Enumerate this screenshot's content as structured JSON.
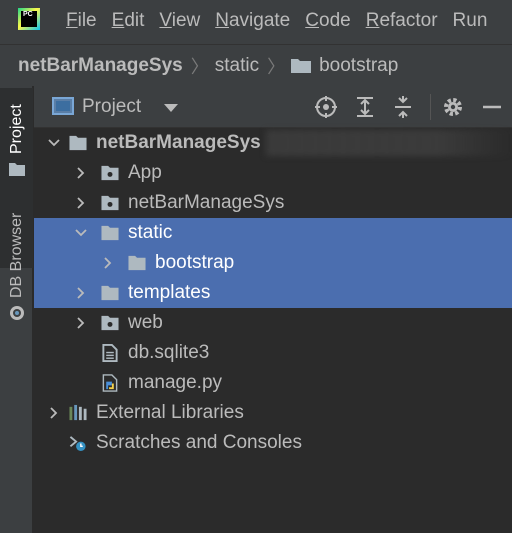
{
  "menu": {
    "logo_text": "PC",
    "items": [
      {
        "mnemonic": "F",
        "rest": "ile"
      },
      {
        "mnemonic": "E",
        "rest": "dit"
      },
      {
        "mnemonic": "V",
        "rest": "iew"
      },
      {
        "mnemonic": "N",
        "rest": "avigate"
      },
      {
        "mnemonic": "C",
        "rest": "ode"
      },
      {
        "mnemonic": "R",
        "rest": "efactor"
      },
      {
        "mnemonic": "",
        "rest": "Run"
      }
    ]
  },
  "breadcrumb": {
    "root": "netBarManageSys",
    "items": [
      "static",
      "bootstrap"
    ]
  },
  "toolstrip": {
    "project_label": "Project",
    "db_label": "DB Browser"
  },
  "panel": {
    "title": "Project"
  },
  "tree": {
    "rows": [
      {
        "label": "netBarManageSys",
        "icon": "folder-icon",
        "level": 0,
        "arrow": "down",
        "selected": false,
        "bold": true
      },
      {
        "label": "App",
        "icon": "package-folder-icon",
        "level": 1,
        "arrow": "right",
        "selected": false
      },
      {
        "label": "netBarManageSys",
        "icon": "package-folder-icon",
        "level": 1,
        "arrow": "right",
        "selected": false
      },
      {
        "label": "static",
        "icon": "folder-icon",
        "level": 1,
        "arrow": "down",
        "selected": true
      },
      {
        "label": "bootstrap",
        "icon": "folder-icon",
        "level": 2,
        "arrow": "right",
        "selected": true
      },
      {
        "label": "templates",
        "icon": "folder-icon",
        "level": 1,
        "arrow": "right",
        "selected": true
      },
      {
        "label": "web",
        "icon": "package-folder-icon",
        "level": 1,
        "arrow": "right",
        "selected": false
      },
      {
        "label": "db.sqlite3",
        "icon": "file-icon",
        "level": 1,
        "arrow": "none",
        "selected": false
      },
      {
        "label": "manage.py",
        "icon": "python-file-icon",
        "level": 1,
        "arrow": "none",
        "selected": false
      },
      {
        "label": "External Libraries",
        "icon": "libraries-icon",
        "level": 0,
        "arrow": "right",
        "selected": false
      },
      {
        "label": "Scratches and Consoles",
        "icon": "scratches-icon",
        "level": 0,
        "arrow": "none",
        "selected": false
      }
    ]
  }
}
